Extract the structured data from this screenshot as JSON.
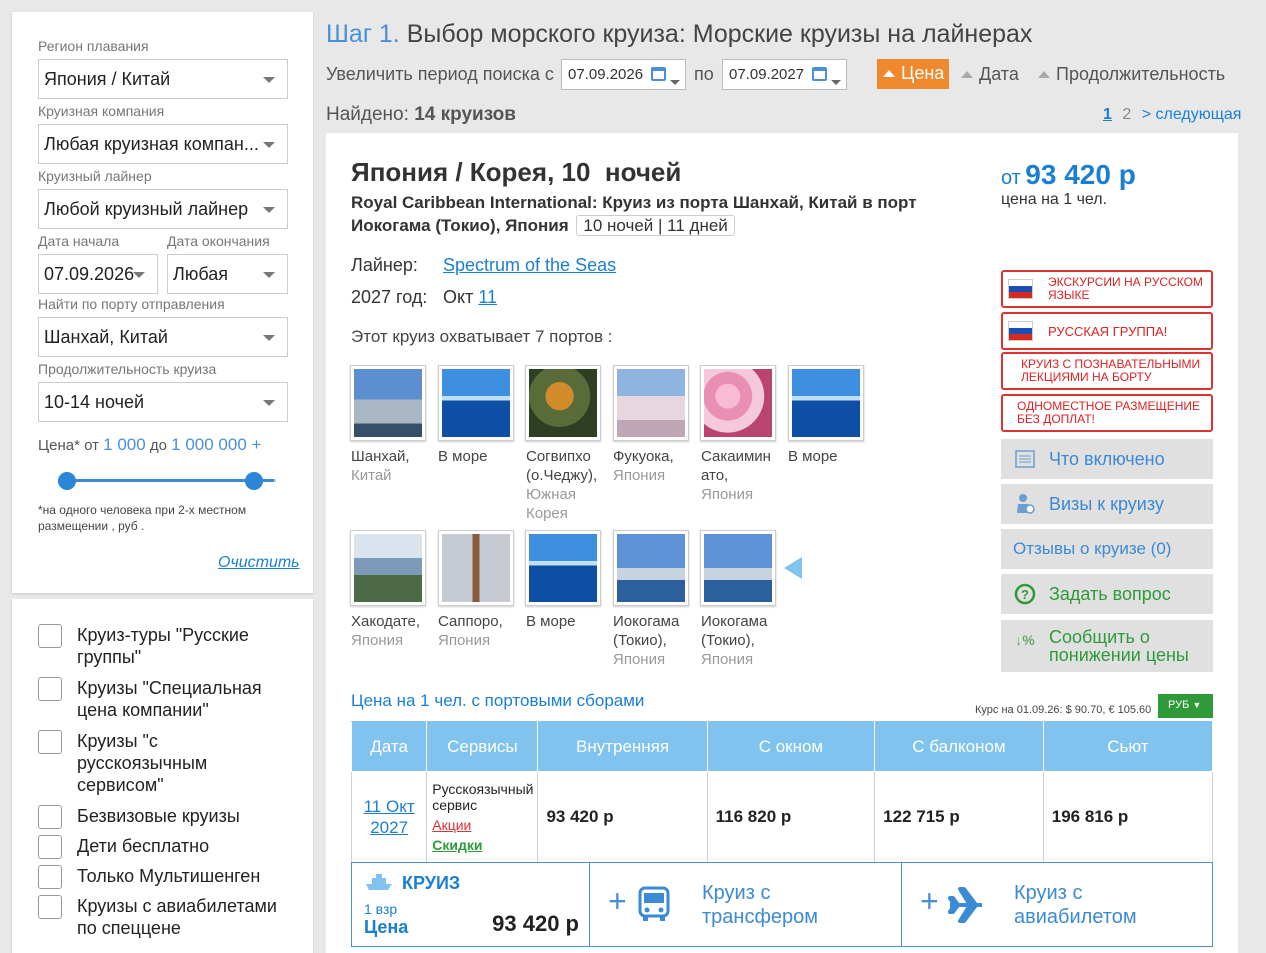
{
  "filter": {
    "region_label": "Регион плавания",
    "region_value": "Япония / Китай",
    "company_label": "Круизная компания",
    "company_value": "Любая круизная компан...",
    "liner_label": "Круизный лайнер",
    "liner_value": "Любой круизный лайнер",
    "start_label": "Дата начала",
    "start_value": "07.09.2026",
    "end_label": "Дата окончания",
    "end_value": "Любая",
    "port_label": "Найти по порту отправления",
    "port_value": "Шанхай, Китай",
    "duration_label": "Продолжительность круиза",
    "duration_value": "10-14 ночей",
    "price_label": "Цена*",
    "price_from_word": "от",
    "price_min": "1 000",
    "price_to_word": "до",
    "price_max": "1 000 000 +",
    "note": "*на одного человека при 2-х местном размещении , руб .",
    "clear": "Очистить"
  },
  "checkboxes": [
    {
      "label": "Круиз-туры \"Русские группы\"",
      "checked": false
    },
    {
      "label": "Круизы \"Специальная цена компании\"",
      "checked": false
    },
    {
      "label": "Круизы \"с русскоязычным сервисом\"",
      "checked": false
    },
    {
      "label": "Безвизовые круизы",
      "checked": false
    },
    {
      "label": "Дети бесплатно",
      "checked": false
    },
    {
      "label": "Только Мультишенген",
      "checked": false
    },
    {
      "label": "Круизы с авиабилетами по спеццене",
      "checked": false
    }
  ],
  "header": {
    "step": "Шаг 1.",
    "title": "Выбор морского круиза: Морские круизы на лайнерах",
    "extend_label": "Увеличить период поиска с",
    "date_from": "07.09.2026",
    "to_word": "по",
    "date_to": "07.09.2027",
    "sort_price": "Цена",
    "sort_date": "Дата",
    "sort_duration": "Продолжительность",
    "found_label": "Найдено:",
    "found_value": "14 круизов",
    "page_current": "1",
    "page_2": "2",
    "page_next": "> следующая"
  },
  "cruise": {
    "title": "Япония / Корея, 10  ночей",
    "route": "Royal Caribbean International: Круиз из порта Шанхай, Китай в порт Иокогама (Токио), Япония",
    "duration_badge": "10 ночей | 11 дней",
    "price_prefix": "от",
    "price": "93 420 р",
    "price_note": "цена на 1 чел.",
    "liner_label": "Лайнер:",
    "liner_name": "Spectrum of the Seas",
    "year_label": "2027 год:",
    "month": "Окт",
    "day": "11",
    "ports_intro": "Этот круиз охватывает 7 портов :",
    "ports": [
      {
        "name": "Шанхай,",
        "country": "Китай",
        "image": "city-skyline"
      },
      {
        "name": "В море",
        "country": "",
        "image": "sea"
      },
      {
        "name": "Согвипхо (о.Чеджу),",
        "country": "Южная Корея",
        "image": "tree-landscape"
      },
      {
        "name": "Фукуока,",
        "country": "Япония",
        "image": "cherry-blossom-city"
      },
      {
        "name": "Сакаимин ато,",
        "country": "Япония",
        "image": "pink-blossom"
      },
      {
        "name": "В море",
        "country": "",
        "image": "sea"
      },
      {
        "name": "Хакодате,",
        "country": "Япония",
        "image": "bay-view"
      },
      {
        "name": "Саппоро,",
        "country": "Япония",
        "image": "tv-tower"
      },
      {
        "name": "В море",
        "country": "",
        "image": "sea"
      },
      {
        "name": "Иокогама (Токио),",
        "country": "Япония",
        "image": "port-city"
      },
      {
        "name": "Иокогама (Токио),",
        "country": "Япония",
        "image": "port-city"
      }
    ],
    "badges": [
      "ЭКСКУРСИИ НА РУССКОМ ЯЗЫКЕ",
      "РУССКАЯ ГРУППА!",
      "КРУИЗ С ПОЗНАВАТЕЛЬНЫМИ ЛЕКЦИЯМИ НА БОРТУ",
      "ОДНОМЕСТНОЕ РАЗМЕЩЕНИЕ БЕЗ ДОПЛАТ!"
    ],
    "buttons": {
      "included": "Что включено",
      "visa": "Визы к круизу",
      "reviews": "Отзывы о круизе (0)",
      "ask": "Задать вопрос",
      "price_drop": "Сообщить о понижении цены"
    },
    "price_section_label": "Цена на 1 чел. с портовыми сборами",
    "rate_note": "Курс на 01.09.26: $ 90.70, € 105.60",
    "currency": "РУБ",
    "table": {
      "headers": [
        "Дата",
        "Сервисы",
        "Внутренняя",
        "С окном",
        "С балконом",
        "Сьют"
      ],
      "date": "11 Окт 2027",
      "service": "Русскоязычный сервис",
      "promo": "Акции",
      "discount": "Скидки",
      "prices": [
        "93 420 р",
        "116 820 р",
        "122 715 р",
        "196 816 р"
      ]
    },
    "bottom": {
      "cruise_label": "КРУИЗ",
      "adults": "1 взр",
      "price_label": "Цена",
      "price": "93 420 р",
      "transfer_option": "Круиз с трансфером",
      "flight_option": "Круиз с авиабилетом"
    }
  },
  "colors": {
    "accent": "#4a90d9",
    "orange": "#f0892e",
    "table_header": "#7fc3ee",
    "badge_red": "#dd2222",
    "green": "#2e9a3a"
  }
}
